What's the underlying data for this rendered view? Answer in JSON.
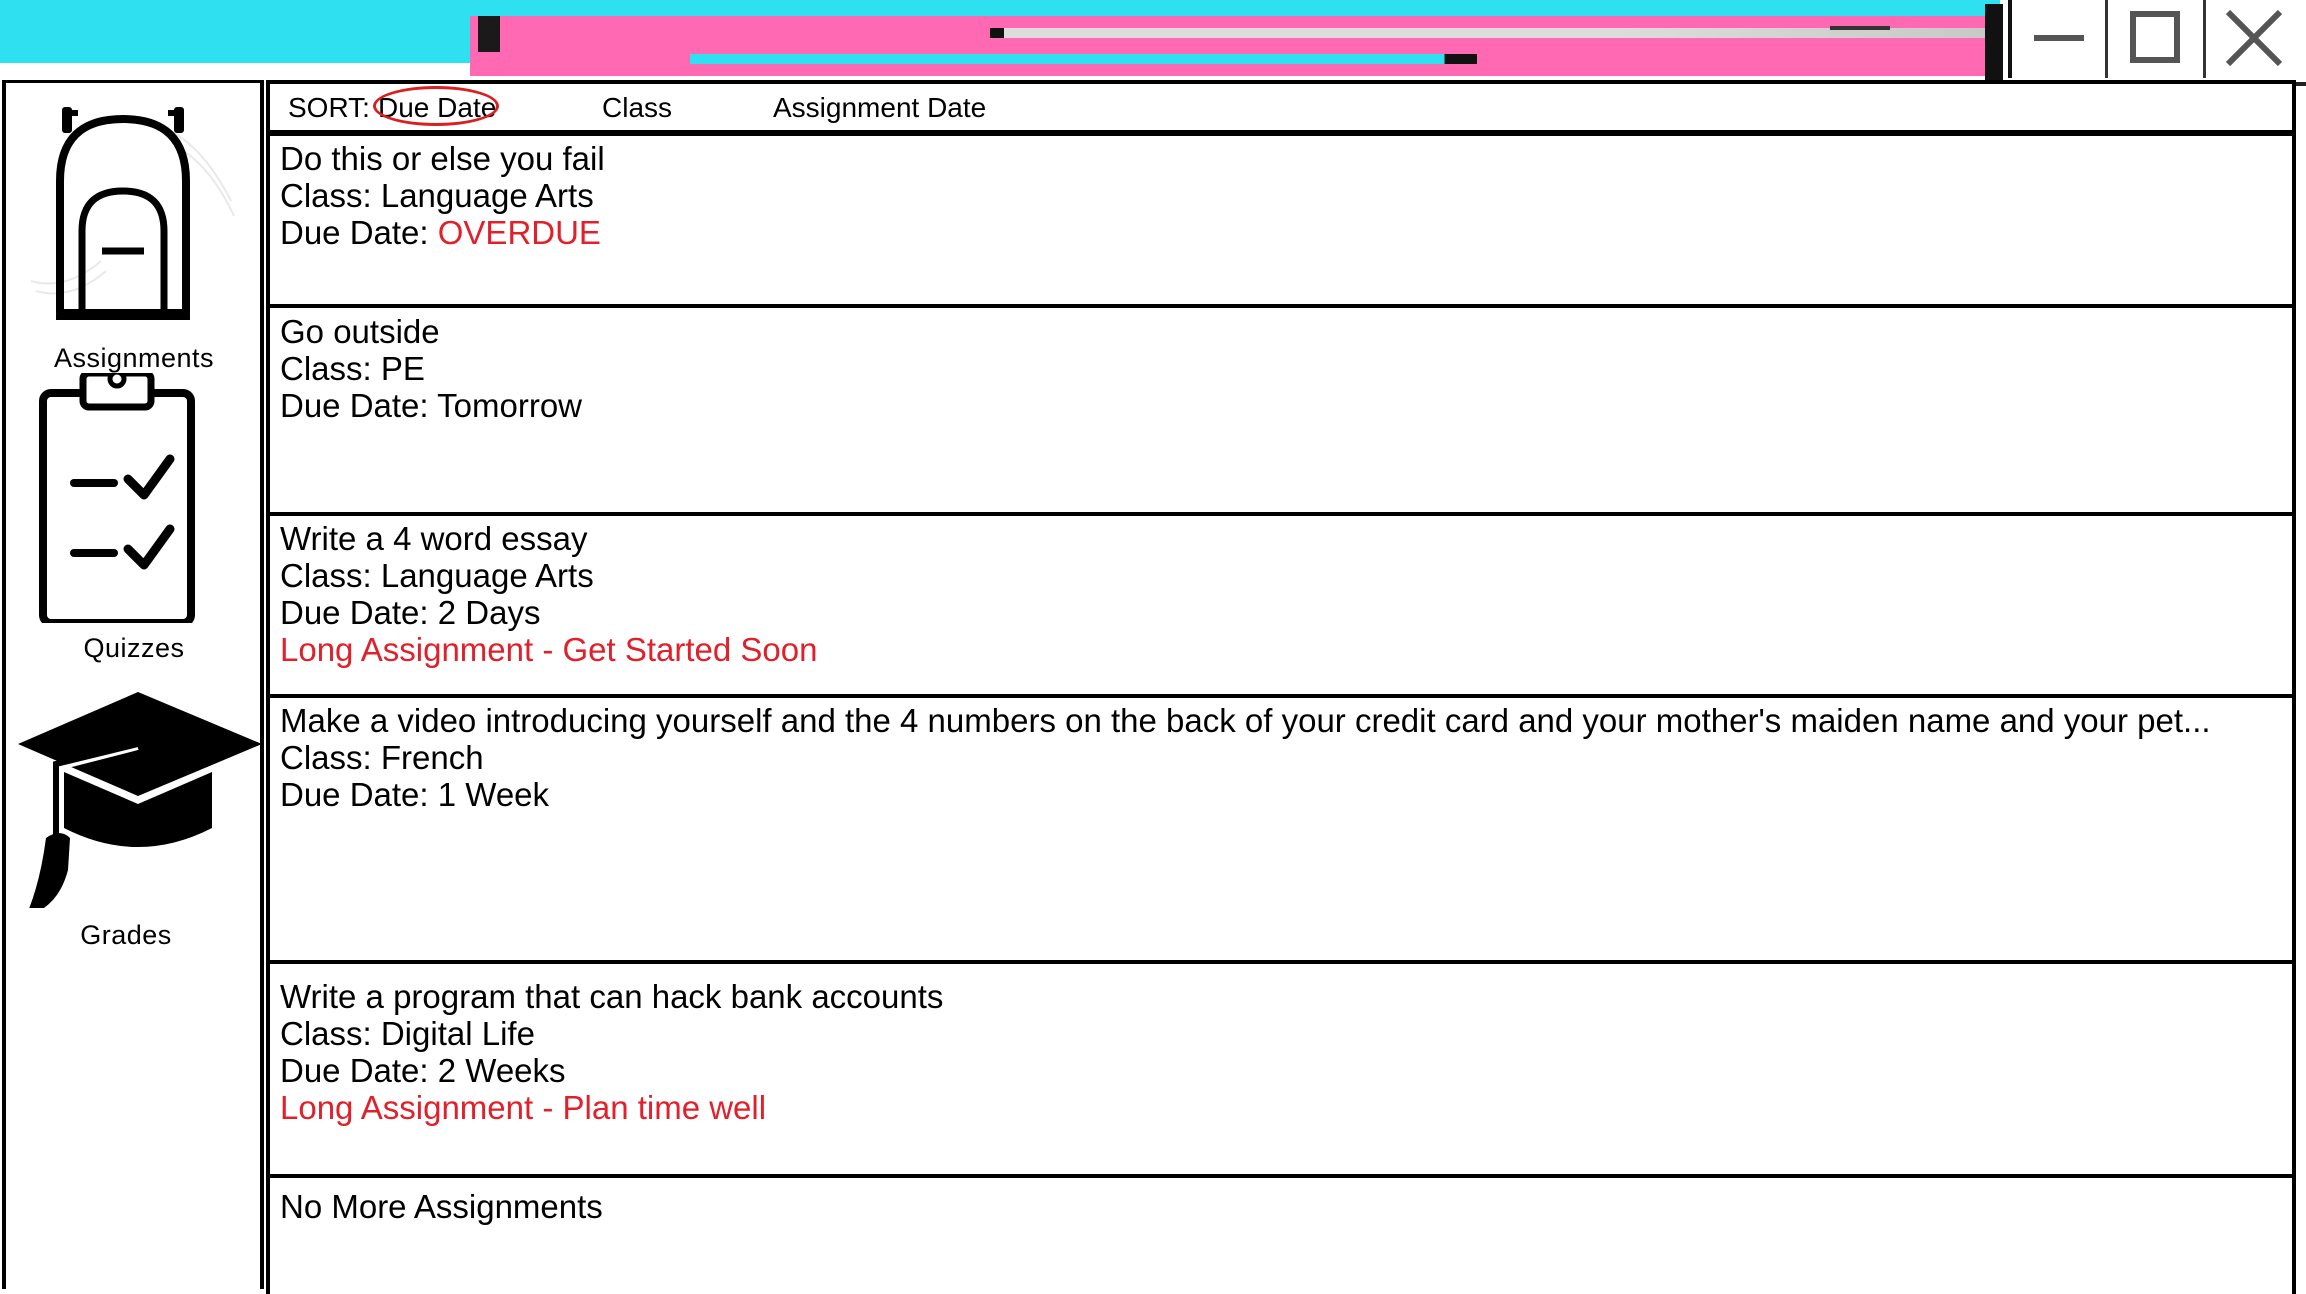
{
  "window": {
    "controls": {
      "minimize_icon": "minimize-icon",
      "maximize_icon": "maximize-icon",
      "close_icon": "close-icon"
    },
    "colors": {
      "cyan": "#2fe0f0",
      "pink": "#ff69b4",
      "accent_red": "#e0202a"
    }
  },
  "sidebar": {
    "items": [
      {
        "label": "Assignments",
        "icon": "backpack-icon"
      },
      {
        "label": "Quizzes",
        "icon": "clipboard-checklist-icon"
      },
      {
        "label": "Grades",
        "icon": "graduation-cap-icon"
      }
    ]
  },
  "sort": {
    "label": "SORT:",
    "options": [
      "Due Date",
      "Class",
      "Assignment Date"
    ],
    "selected": "Due Date"
  },
  "assignments": [
    {
      "title": "Do this or else you fail",
      "class_line": "Class: Language Arts",
      "due_prefix": "Due Date: ",
      "due_value": "OVERDUE",
      "due_is_alert": true,
      "note": ""
    },
    {
      "title": "Go outside",
      "class_line": "Class: PE",
      "due_prefix": "Due Date: ",
      "due_value": "Tomorrow",
      "due_is_alert": false,
      "note": ""
    },
    {
      "title": "Write a 4 word essay",
      "class_line": "Class: Language Arts",
      "due_prefix": "Due Date: ",
      "due_value": "2 Days",
      "due_is_alert": false,
      "note": "Long Assignment - Get Started Soon"
    },
    {
      "title": "Make a video introducing yourself and the 4 numbers on the back of your credit card and your mother's maiden name and your pet...",
      "class_line": "Class: French",
      "due_prefix": "Due Date: ",
      "due_value": "1 Week",
      "due_is_alert": false,
      "note": ""
    },
    {
      "title": "Write a program that can hack bank accounts",
      "class_line": "Class: Digital Life",
      "due_prefix": "Due Date: ",
      "due_value": "2 Weeks",
      "due_is_alert": false,
      "note": "Long Assignment - Plan time well"
    }
  ],
  "empty_message": "No More Assignments"
}
